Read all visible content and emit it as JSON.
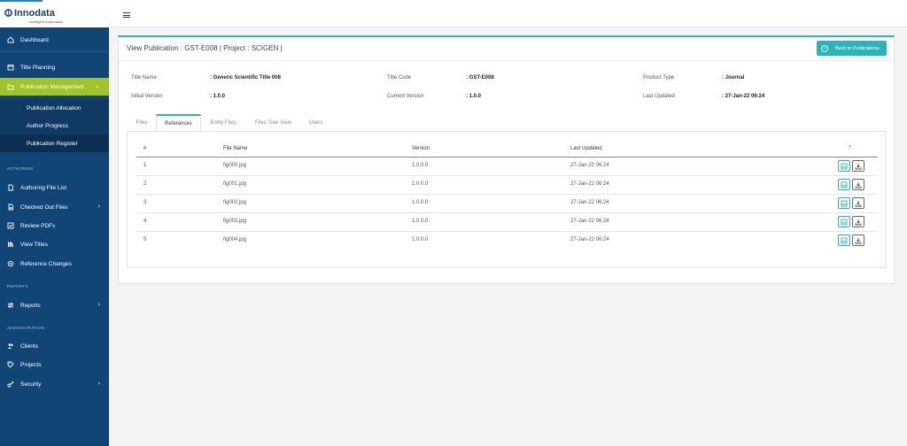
{
  "brand": {
    "name": "Innodata",
    "tagline": "Intelligent Automation"
  },
  "sidebar": {
    "items": [
      {
        "label": "Dashboard",
        "icon": "home-icon"
      },
      {
        "label": "Title Planning",
        "icon": "calendar-icon"
      },
      {
        "label": "Publication Management",
        "icon": "folder-icon",
        "active": true
      }
    ],
    "sub_items": [
      {
        "label": "Publication Allocation"
      },
      {
        "label": "Author Progress"
      },
      {
        "label": "Publication Register",
        "selected": true
      }
    ],
    "sections": {
      "authoring": "AUTHORING",
      "reports": "REPORTS",
      "administration": "ADMINISTRATION"
    },
    "authoring_items": [
      {
        "label": "Authoring File List",
        "icon": "file-icon"
      },
      {
        "label": "Checked Out Files",
        "icon": "file-lock-icon"
      },
      {
        "label": "Review PDFs",
        "icon": "check-square-icon"
      },
      {
        "label": "View Titles",
        "icon": "books-icon"
      },
      {
        "label": "Reference Changes",
        "icon": "exchange-icon"
      }
    ],
    "report_items": [
      {
        "label": "Reports",
        "icon": "sliders-icon"
      }
    ],
    "admin_items": [
      {
        "label": "Clients",
        "icon": "users-icon"
      },
      {
        "label": "Projects",
        "icon": "tag-icon"
      },
      {
        "label": "Security",
        "icon": "key-icon"
      }
    ]
  },
  "panel": {
    "title_prefix": "View Publication : ",
    "title_code": "GST-E008",
    "title_sep": " | Project : ",
    "title_project": "SCIGEN",
    "title_suffix": " |",
    "back_label": "Back to Publications"
  },
  "meta": {
    "title_name_label": "Title Name",
    "title_name_value": ": Generic Scientific Title 008",
    "title_code_label": "Title Code",
    "title_code_value": ": GST-E008",
    "product_type_label": "Product Type",
    "product_type_value": ": Journal",
    "initial_version_label": "Initial Version",
    "initial_version_value": ": 1.0.0",
    "current_version_label": "Current Version",
    "current_version_value": ": 1.0.0",
    "last_updated_label": "Last Updated",
    "last_updated_value": ": 27-Jan-22 06:24"
  },
  "tabs": [
    "Files",
    "References",
    "Entity Files",
    "Files Tree View",
    "Users"
  ],
  "table": {
    "headers": [
      "#",
      "File Name",
      "Version",
      "Last Updated"
    ],
    "rows": [
      {
        "num": "1",
        "file": "fig000.jpg",
        "version": "1.0.0.0",
        "updated": "27-Jan-22 06:24"
      },
      {
        "num": "2",
        "file": "fig001.jpg",
        "version": "1.0.0.0",
        "updated": "27-Jan-22 06:24"
      },
      {
        "num": "3",
        "file": "fig002.jpg",
        "version": "1.0.0.0",
        "updated": "27-Jan-22 06:24"
      },
      {
        "num": "4",
        "file": "fig003.jpg",
        "version": "1.0.0.0",
        "updated": "27-Jan-22 06:24"
      },
      {
        "num": "5",
        "file": "fig004.jpg",
        "version": "1.0.0.0",
        "updated": "27-Jan-22 06:24"
      }
    ]
  },
  "colors": {
    "sidebar": "#114576",
    "active": "#9ec529",
    "accent": "#2bb5b8"
  }
}
